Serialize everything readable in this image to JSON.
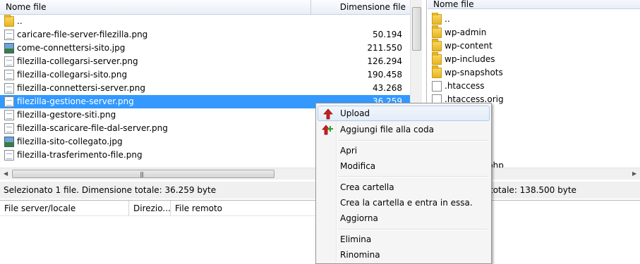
{
  "left_pane": {
    "header_name": "Nome file",
    "header_size": "Dimensione file",
    "rows": [
      {
        "icon": "folder-icon",
        "name": "..",
        "size": ""
      },
      {
        "icon": "png-file-icon",
        "name": "caricare-file-server-filezilla.png",
        "size": "50.194"
      },
      {
        "icon": "jpg-file-icon",
        "name": "come-connettersi-sito.jpg",
        "size": "211.550"
      },
      {
        "icon": "png-file-icon",
        "name": "filezilla-collegarsi-server.png",
        "size": "126.294"
      },
      {
        "icon": "png-file-icon",
        "name": "filezilla-collegarsi-sito.png",
        "size": "190.458"
      },
      {
        "icon": "png-file-icon",
        "name": "filezilla-connettersi-server.png",
        "size": "43.268"
      },
      {
        "icon": "png-file-icon",
        "name": "filezilla-gestione-server.png",
        "size": "36.259",
        "selected": true
      },
      {
        "icon": "png-file-icon",
        "name": "filezilla-gestore-siti.png",
        "size": ""
      },
      {
        "icon": "png-file-icon",
        "name": "filezilla-scaricare-file-dal-server.png",
        "size": ""
      },
      {
        "icon": "jpg-file-icon",
        "name": "filezilla-sito-collegato.jpg",
        "size": ""
      },
      {
        "icon": "png-file-icon",
        "name": "filezilla-trasferimento-file.png",
        "size": ""
      }
    ],
    "status": "Selezionato 1 file. Dimensione totale: 36.259 byte"
  },
  "right_pane": {
    "header_name": "Nome file",
    "rows": [
      {
        "icon": "folder-icon",
        "name": ".."
      },
      {
        "icon": "folder-icon",
        "name": "wp-admin"
      },
      {
        "icon": "folder-icon",
        "name": "wp-content"
      },
      {
        "icon": "folder-icon",
        "name": "wp-includes"
      },
      {
        "icon": "folder-icon",
        "name": "wp-snapshots"
      },
      {
        "icon": "document-icon",
        "name": ".htaccess"
      },
      {
        "icon": "document-icon",
        "name": ".htaccess.orig"
      }
    ],
    "partial_text": "php",
    "status": "e. Dimensione totale: 138.500 byte"
  },
  "queue": {
    "col_local": "File server/locale",
    "col_direction": "Direzio...",
    "col_remote": "File remoto"
  },
  "context_menu": {
    "items": [
      {
        "label": "Upload",
        "icon": "upload-arrow-icon"
      },
      {
        "label": "Aggiungi file alla coda",
        "icon": "add-to-queue-icon"
      },
      {
        "label": "Apri"
      },
      {
        "label": "Modifica"
      },
      {
        "label": "Crea cartella"
      },
      {
        "label": "Crea la cartella e entra in essa."
      },
      {
        "label": "Aggiorna"
      },
      {
        "label": "Elimina"
      },
      {
        "label": "Rinomina"
      }
    ]
  },
  "colors": {
    "selection": "#3399ff",
    "menu_bg": "#f5f5f5",
    "upload_red": "#cc1f1f",
    "add_green": "#2fa12f"
  }
}
